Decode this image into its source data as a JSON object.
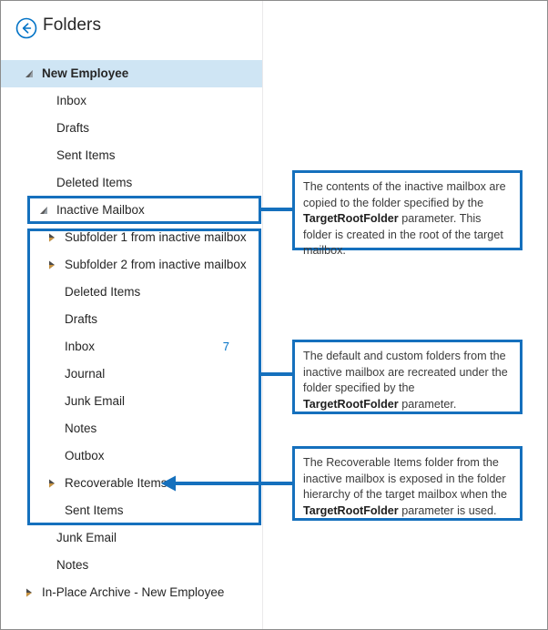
{
  "header": {
    "back_icon": "back-circle-arrow-icon",
    "title": "Folders"
  },
  "tree": {
    "rows": [
      {
        "label": "New Employee",
        "depth": 0,
        "marker": "expanded",
        "selected": true,
        "count": ""
      },
      {
        "label": "Inbox",
        "depth": 1,
        "marker": "none",
        "selected": false,
        "count": ""
      },
      {
        "label": "Drafts",
        "depth": 1,
        "marker": "none",
        "selected": false,
        "count": ""
      },
      {
        "label": "Sent Items",
        "depth": 1,
        "marker": "none",
        "selected": false,
        "count": ""
      },
      {
        "label": "Deleted Items",
        "depth": 1,
        "marker": "none",
        "selected": false,
        "count": ""
      },
      {
        "label": "Inactive Mailbox",
        "depth": 1,
        "marker": "expanded",
        "selected": false,
        "count": ""
      },
      {
        "label": "Subfolder 1 from inactive mailbox",
        "depth": 2,
        "marker": "collapsed",
        "selected": false,
        "count": ""
      },
      {
        "label": "Subfolder 2 from inactive mailbox",
        "depth": 2,
        "marker": "collapsed",
        "selected": false,
        "count": ""
      },
      {
        "label": "Deleted Items",
        "depth": 2,
        "marker": "none",
        "selected": false,
        "count": ""
      },
      {
        "label": "Drafts",
        "depth": 2,
        "marker": "none",
        "selected": false,
        "count": ""
      },
      {
        "label": "Inbox",
        "depth": 2,
        "marker": "none",
        "selected": false,
        "count": "7"
      },
      {
        "label": "Journal",
        "depth": 2,
        "marker": "none",
        "selected": false,
        "count": ""
      },
      {
        "label": "Junk Email",
        "depth": 2,
        "marker": "none",
        "selected": false,
        "count": ""
      },
      {
        "label": "Notes",
        "depth": 2,
        "marker": "none",
        "selected": false,
        "count": ""
      },
      {
        "label": "Outbox",
        "depth": 2,
        "marker": "none",
        "selected": false,
        "count": ""
      },
      {
        "label": "Recoverable Items",
        "depth": 2,
        "marker": "collapsed",
        "selected": false,
        "count": ""
      },
      {
        "label": "Sent Items",
        "depth": 2,
        "marker": "none",
        "selected": false,
        "count": ""
      },
      {
        "label": "Junk Email",
        "depth": 1,
        "marker": "none",
        "selected": false,
        "count": ""
      },
      {
        "label": "Notes",
        "depth": 1,
        "marker": "none",
        "selected": false,
        "count": ""
      },
      {
        "label": "In-Place Archive - New Employee",
        "depth": 0,
        "marker": "collapsed",
        "selected": false,
        "count": ""
      }
    ]
  },
  "callouts": [
    {
      "id": "callout-target-root-folder",
      "text_parts": [
        {
          "type": "text",
          "value": "The contents of the inactive mailbox are copied to the folder specified by the "
        },
        {
          "type": "bold",
          "value": "TargetRootFolder"
        },
        {
          "type": "text",
          "value": " parameter. This folder is created in the root of the target mailbox."
        }
      ]
    },
    {
      "id": "callout-default-custom-folders",
      "text_parts": [
        {
          "type": "text",
          "value": "The default and custom folders from the inactive mailbox are recreated under the folder specified by the "
        },
        {
          "type": "bold",
          "value": "TargetRootFolder"
        },
        {
          "type": "text",
          "value": " parameter."
        }
      ]
    },
    {
      "id": "callout-recoverable-items",
      "text_parts": [
        {
          "type": "text",
          "value": "The Recoverable Items folder from the inactive mailbox is exposed in the folder hierarchy of the target mailbox when the "
        },
        {
          "type": "bold",
          "value": "TargetRootFolder"
        },
        {
          "type": "text",
          "value": " parameter is used."
        }
      ]
    }
  ],
  "colors": {
    "accent": "#1570bd",
    "selection": "#cfe5f4",
    "link": "#0072c6",
    "text": "#262626",
    "divider": "#ebe9eb",
    "frame": "#8c8c8c"
  }
}
